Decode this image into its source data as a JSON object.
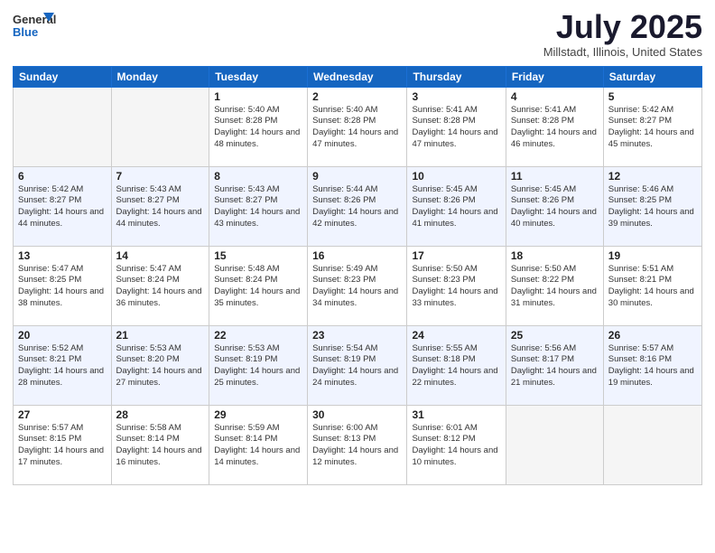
{
  "logo": {
    "text_general": "General",
    "text_blue": "Blue"
  },
  "header": {
    "month": "July 2025",
    "location": "Millstadt, Illinois, United States"
  },
  "weekdays": [
    "Sunday",
    "Monday",
    "Tuesday",
    "Wednesday",
    "Thursday",
    "Friday",
    "Saturday"
  ],
  "weeks": [
    [
      {
        "day": "",
        "sunrise": "",
        "sunset": "",
        "daylight": "",
        "empty": true
      },
      {
        "day": "",
        "sunrise": "",
        "sunset": "",
        "daylight": "",
        "empty": true
      },
      {
        "day": "1",
        "sunrise": "Sunrise: 5:40 AM",
        "sunset": "Sunset: 8:28 PM",
        "daylight": "Daylight: 14 hours and 48 minutes."
      },
      {
        "day": "2",
        "sunrise": "Sunrise: 5:40 AM",
        "sunset": "Sunset: 8:28 PM",
        "daylight": "Daylight: 14 hours and 47 minutes."
      },
      {
        "day": "3",
        "sunrise": "Sunrise: 5:41 AM",
        "sunset": "Sunset: 8:28 PM",
        "daylight": "Daylight: 14 hours and 47 minutes."
      },
      {
        "day": "4",
        "sunrise": "Sunrise: 5:41 AM",
        "sunset": "Sunset: 8:28 PM",
        "daylight": "Daylight: 14 hours and 46 minutes."
      },
      {
        "day": "5",
        "sunrise": "Sunrise: 5:42 AM",
        "sunset": "Sunset: 8:27 PM",
        "daylight": "Daylight: 14 hours and 45 minutes."
      }
    ],
    [
      {
        "day": "6",
        "sunrise": "Sunrise: 5:42 AM",
        "sunset": "Sunset: 8:27 PM",
        "daylight": "Daylight: 14 hours and 44 minutes."
      },
      {
        "day": "7",
        "sunrise": "Sunrise: 5:43 AM",
        "sunset": "Sunset: 8:27 PM",
        "daylight": "Daylight: 14 hours and 44 minutes."
      },
      {
        "day": "8",
        "sunrise": "Sunrise: 5:43 AM",
        "sunset": "Sunset: 8:27 PM",
        "daylight": "Daylight: 14 hours and 43 minutes."
      },
      {
        "day": "9",
        "sunrise": "Sunrise: 5:44 AM",
        "sunset": "Sunset: 8:26 PM",
        "daylight": "Daylight: 14 hours and 42 minutes."
      },
      {
        "day": "10",
        "sunrise": "Sunrise: 5:45 AM",
        "sunset": "Sunset: 8:26 PM",
        "daylight": "Daylight: 14 hours and 41 minutes."
      },
      {
        "day": "11",
        "sunrise": "Sunrise: 5:45 AM",
        "sunset": "Sunset: 8:26 PM",
        "daylight": "Daylight: 14 hours and 40 minutes."
      },
      {
        "day": "12",
        "sunrise": "Sunrise: 5:46 AM",
        "sunset": "Sunset: 8:25 PM",
        "daylight": "Daylight: 14 hours and 39 minutes."
      }
    ],
    [
      {
        "day": "13",
        "sunrise": "Sunrise: 5:47 AM",
        "sunset": "Sunset: 8:25 PM",
        "daylight": "Daylight: 14 hours and 38 minutes."
      },
      {
        "day": "14",
        "sunrise": "Sunrise: 5:47 AM",
        "sunset": "Sunset: 8:24 PM",
        "daylight": "Daylight: 14 hours and 36 minutes."
      },
      {
        "day": "15",
        "sunrise": "Sunrise: 5:48 AM",
        "sunset": "Sunset: 8:24 PM",
        "daylight": "Daylight: 14 hours and 35 minutes."
      },
      {
        "day": "16",
        "sunrise": "Sunrise: 5:49 AM",
        "sunset": "Sunset: 8:23 PM",
        "daylight": "Daylight: 14 hours and 34 minutes."
      },
      {
        "day": "17",
        "sunrise": "Sunrise: 5:50 AM",
        "sunset": "Sunset: 8:23 PM",
        "daylight": "Daylight: 14 hours and 33 minutes."
      },
      {
        "day": "18",
        "sunrise": "Sunrise: 5:50 AM",
        "sunset": "Sunset: 8:22 PM",
        "daylight": "Daylight: 14 hours and 31 minutes."
      },
      {
        "day": "19",
        "sunrise": "Sunrise: 5:51 AM",
        "sunset": "Sunset: 8:21 PM",
        "daylight": "Daylight: 14 hours and 30 minutes."
      }
    ],
    [
      {
        "day": "20",
        "sunrise": "Sunrise: 5:52 AM",
        "sunset": "Sunset: 8:21 PM",
        "daylight": "Daylight: 14 hours and 28 minutes."
      },
      {
        "day": "21",
        "sunrise": "Sunrise: 5:53 AM",
        "sunset": "Sunset: 8:20 PM",
        "daylight": "Daylight: 14 hours and 27 minutes."
      },
      {
        "day": "22",
        "sunrise": "Sunrise: 5:53 AM",
        "sunset": "Sunset: 8:19 PM",
        "daylight": "Daylight: 14 hours and 25 minutes."
      },
      {
        "day": "23",
        "sunrise": "Sunrise: 5:54 AM",
        "sunset": "Sunset: 8:19 PM",
        "daylight": "Daylight: 14 hours and 24 minutes."
      },
      {
        "day": "24",
        "sunrise": "Sunrise: 5:55 AM",
        "sunset": "Sunset: 8:18 PM",
        "daylight": "Daylight: 14 hours and 22 minutes."
      },
      {
        "day": "25",
        "sunrise": "Sunrise: 5:56 AM",
        "sunset": "Sunset: 8:17 PM",
        "daylight": "Daylight: 14 hours and 21 minutes."
      },
      {
        "day": "26",
        "sunrise": "Sunrise: 5:57 AM",
        "sunset": "Sunset: 8:16 PM",
        "daylight": "Daylight: 14 hours and 19 minutes."
      }
    ],
    [
      {
        "day": "27",
        "sunrise": "Sunrise: 5:57 AM",
        "sunset": "Sunset: 8:15 PM",
        "daylight": "Daylight: 14 hours and 17 minutes."
      },
      {
        "day": "28",
        "sunrise": "Sunrise: 5:58 AM",
        "sunset": "Sunset: 8:14 PM",
        "daylight": "Daylight: 14 hours and 16 minutes."
      },
      {
        "day": "29",
        "sunrise": "Sunrise: 5:59 AM",
        "sunset": "Sunset: 8:14 PM",
        "daylight": "Daylight: 14 hours and 14 minutes."
      },
      {
        "day": "30",
        "sunrise": "Sunrise: 6:00 AM",
        "sunset": "Sunset: 8:13 PM",
        "daylight": "Daylight: 14 hours and 12 minutes."
      },
      {
        "day": "31",
        "sunrise": "Sunrise: 6:01 AM",
        "sunset": "Sunset: 8:12 PM",
        "daylight": "Daylight: 14 hours and 10 minutes."
      },
      {
        "day": "",
        "sunrise": "",
        "sunset": "",
        "daylight": "",
        "empty": true
      },
      {
        "day": "",
        "sunrise": "",
        "sunset": "",
        "daylight": "",
        "empty": true
      }
    ]
  ]
}
